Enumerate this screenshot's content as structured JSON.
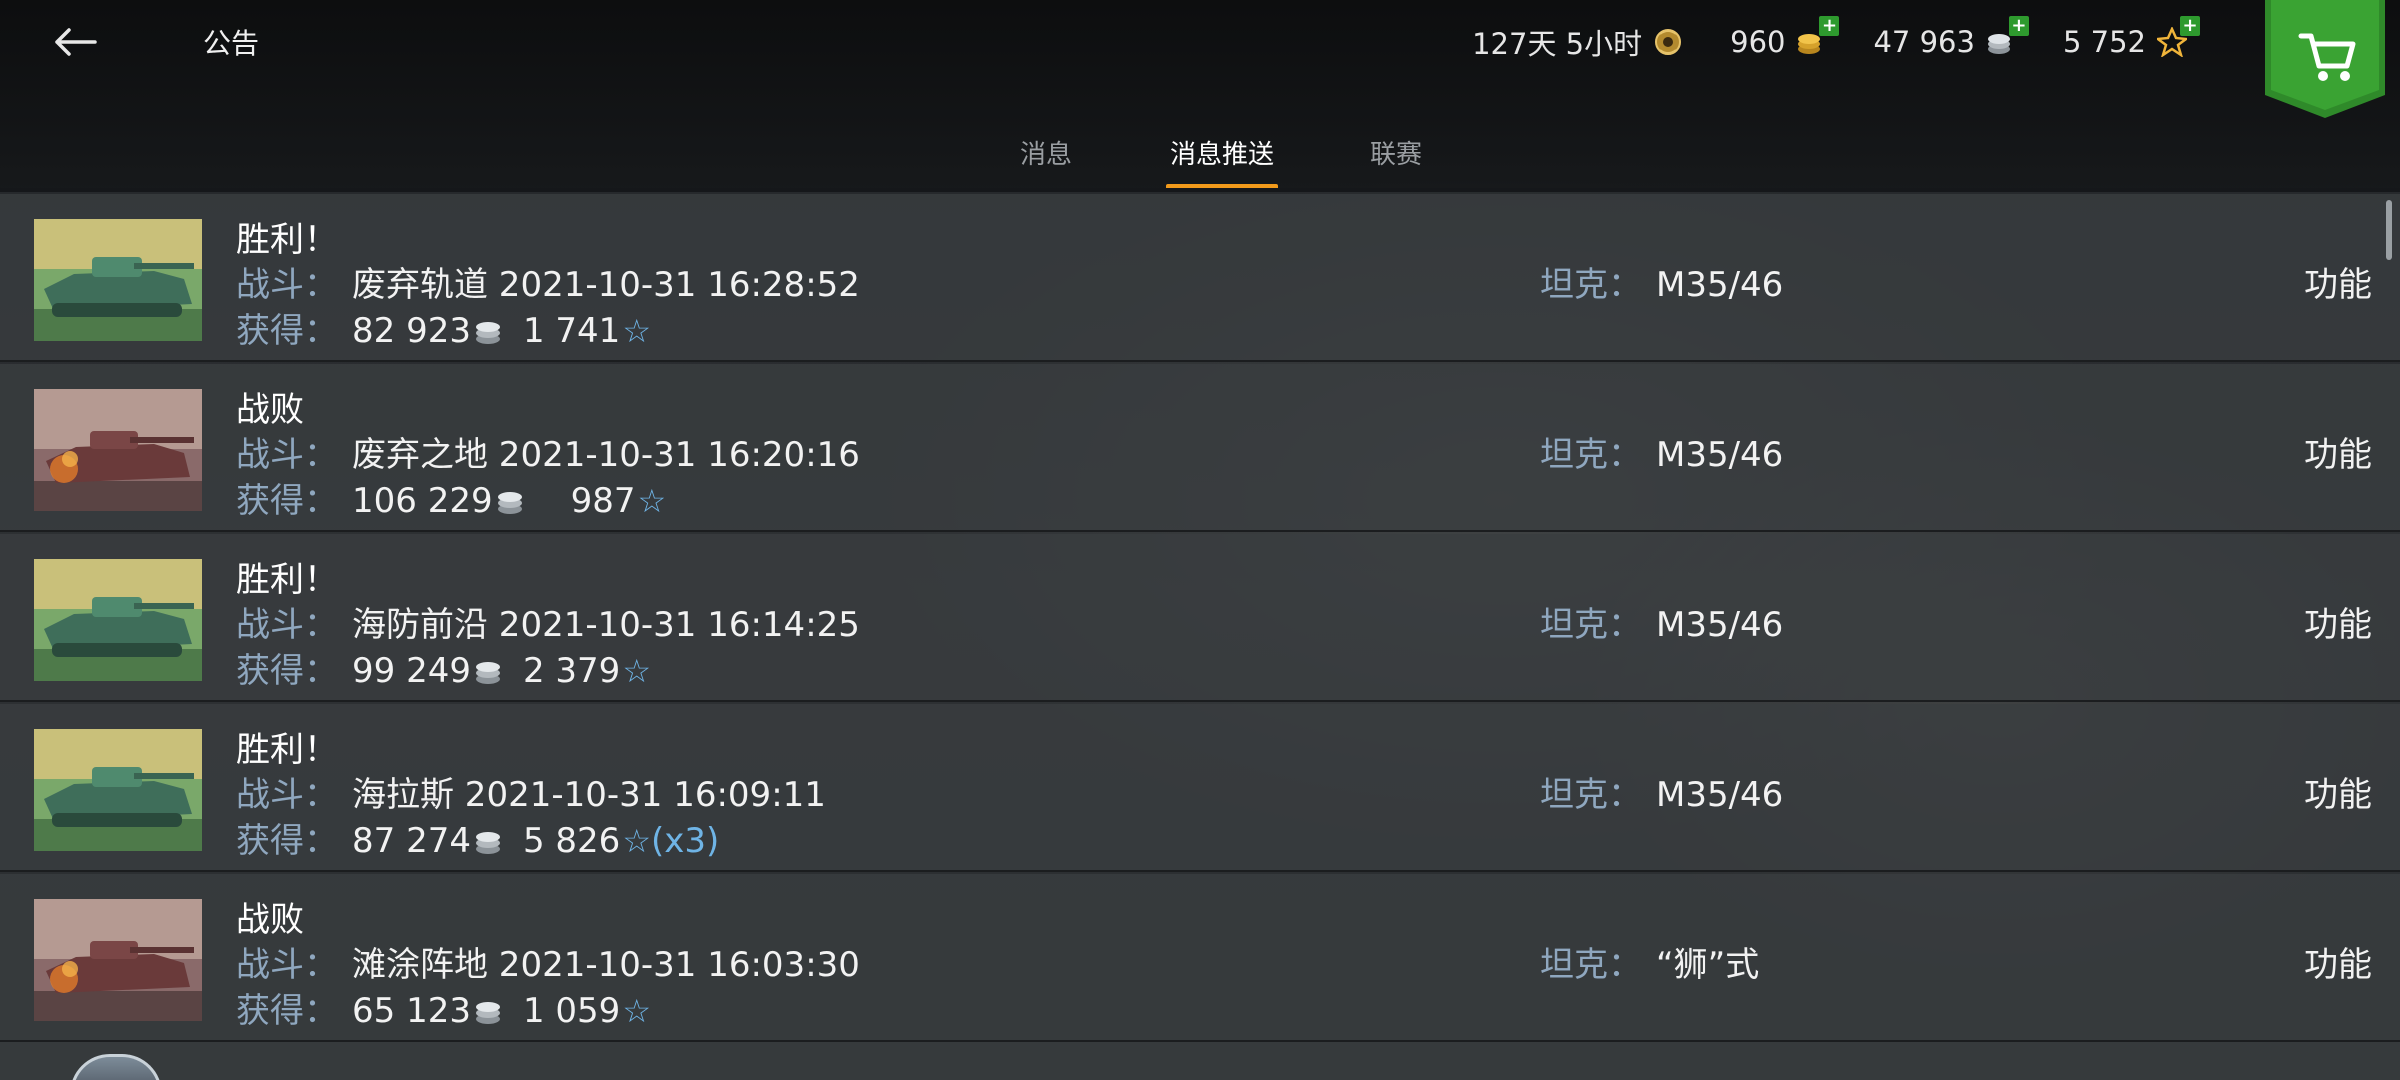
{
  "header": {
    "back_icon": "back-arrow-icon",
    "title": "公告",
    "premium_time": "127天 5小时",
    "gold": "960",
    "silver": "47 963",
    "free_xp": "5 752",
    "cart_icon": "shopping-cart-icon"
  },
  "tabs": [
    {
      "label": "消息",
      "active": false
    },
    {
      "label": "消息推送",
      "active": true
    },
    {
      "label": "联赛",
      "active": false
    }
  ],
  "colors": {
    "accent": "#f29a1b",
    "label_blue": "#8fa7bf",
    "star_blue": "#6fb4e6",
    "shop_green": "#2f8a2a"
  },
  "labels": {
    "battle": "战斗：",
    "earned": "获得：",
    "tank": "坦克：",
    "function": "功能"
  },
  "messages": [
    {
      "result": "胜利！",
      "outcome": "victory",
      "battle": "废弃轨道 2021-10-31 16:28:52",
      "silver": "82 923",
      "xp": "1 741",
      "multiplier": "",
      "tank": "M35/46"
    },
    {
      "result": "战败",
      "outcome": "defeat",
      "battle": "废弃之地 2021-10-31 16:20:16",
      "silver": "106 229",
      "xp": "987",
      "multiplier": "",
      "tank": "M35/46"
    },
    {
      "result": "胜利！",
      "outcome": "victory",
      "battle": "海防前沿 2021-10-31 16:14:25",
      "silver": "99 249",
      "xp": "2 379",
      "multiplier": "",
      "tank": "M35/46"
    },
    {
      "result": "胜利！",
      "outcome": "victory",
      "battle": "海拉斯 2021-10-31 16:09:11",
      "silver": "87 274",
      "xp": "5 826",
      "multiplier": "(x3)",
      "tank": "M35/46"
    },
    {
      "result": "战败",
      "outcome": "defeat",
      "battle": "滩涂阵地 2021-10-31 16:03:30",
      "silver": "65 123",
      "xp": "1 059",
      "multiplier": "",
      "tank": "“狮”式"
    }
  ]
}
